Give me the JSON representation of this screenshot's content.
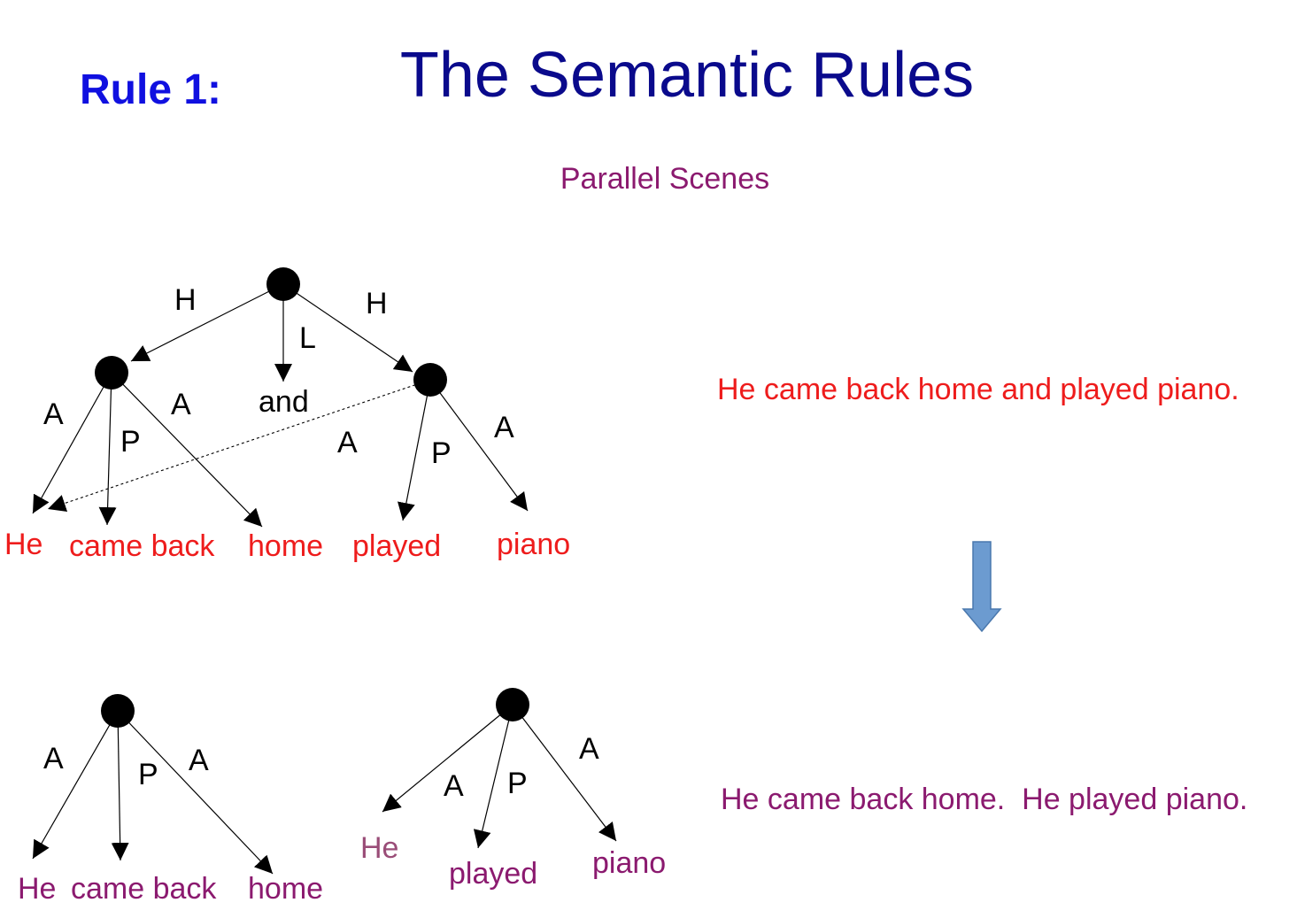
{
  "header": {
    "rule_label": "Rule 1:",
    "title": "The Semantic Rules",
    "subtitle": "Parallel Scenes"
  },
  "top_graph": {
    "edge_labels": {
      "h_left": "H",
      "l": "L",
      "h_right": "H",
      "a_he": "A",
      "p_came_back": "P",
      "a_home": "A",
      "a_remote": "A",
      "p_played": "P",
      "a_piano": "A"
    },
    "linker": "and",
    "leaves": [
      "He",
      "came back",
      "home",
      "played",
      "piano"
    ]
  },
  "bottom_graph_1": {
    "edge_labels": {
      "a_he": "A",
      "p": "P",
      "a_home": "A"
    },
    "leaves": [
      "He",
      "came back",
      "home"
    ]
  },
  "bottom_graph_2": {
    "edge_labels": {
      "a_he": "A",
      "p": "P",
      "a_piano": "A"
    },
    "leaves": [
      "He",
      "played",
      "piano"
    ]
  },
  "sentences": {
    "original": "He came back home and played piano.",
    "transformed": "He came back home.  He played piano."
  },
  "colors": {
    "rule_label": "#1010e0",
    "title": "#0a0a8c",
    "original_text": "#ee1c1c",
    "transformed_text": "#8b1a6f",
    "arrow_fill": "#6c9bd0",
    "arrow_stroke": "#4a78ad"
  }
}
